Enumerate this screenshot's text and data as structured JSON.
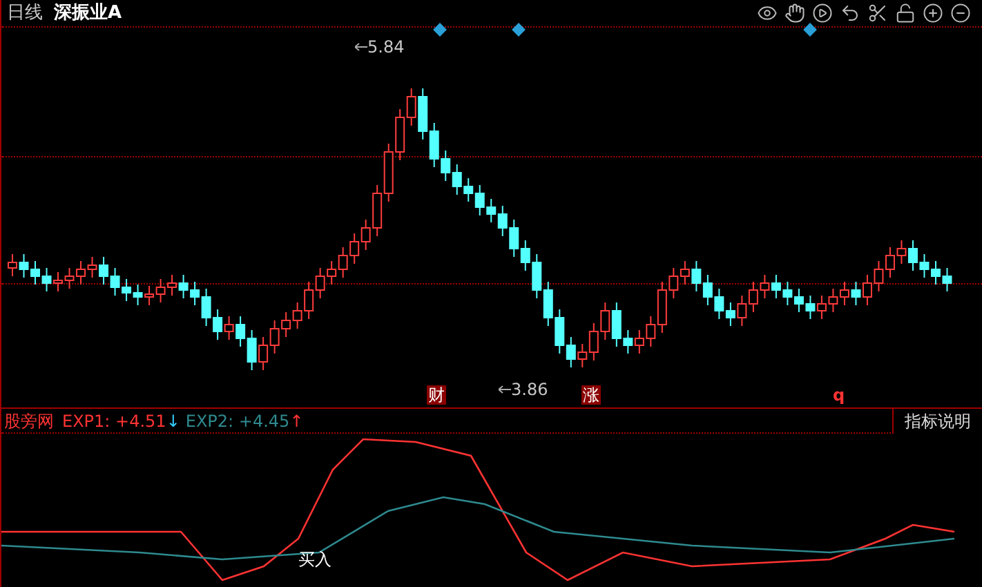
{
  "header": {
    "period": "日线",
    "security": "深振业A"
  },
  "price_labels": {
    "high": "5.84",
    "low": "3.86"
  },
  "event_markers": [
    {
      "text": "财",
      "kind": "boxed"
    },
    {
      "text": "涨",
      "kind": "boxed"
    },
    {
      "text": "q",
      "kind": "plain"
    }
  ],
  "indicator": {
    "name": "股旁网",
    "lines": [
      {
        "label": "EXP1: +4.51",
        "arrow": "↓",
        "color": "#ff3333"
      },
      {
        "label": "EXP2: +4.45",
        "arrow": "↑",
        "color": "#2e8a8f"
      }
    ],
    "help_button": "指标说明",
    "signal": "买入"
  }
}
